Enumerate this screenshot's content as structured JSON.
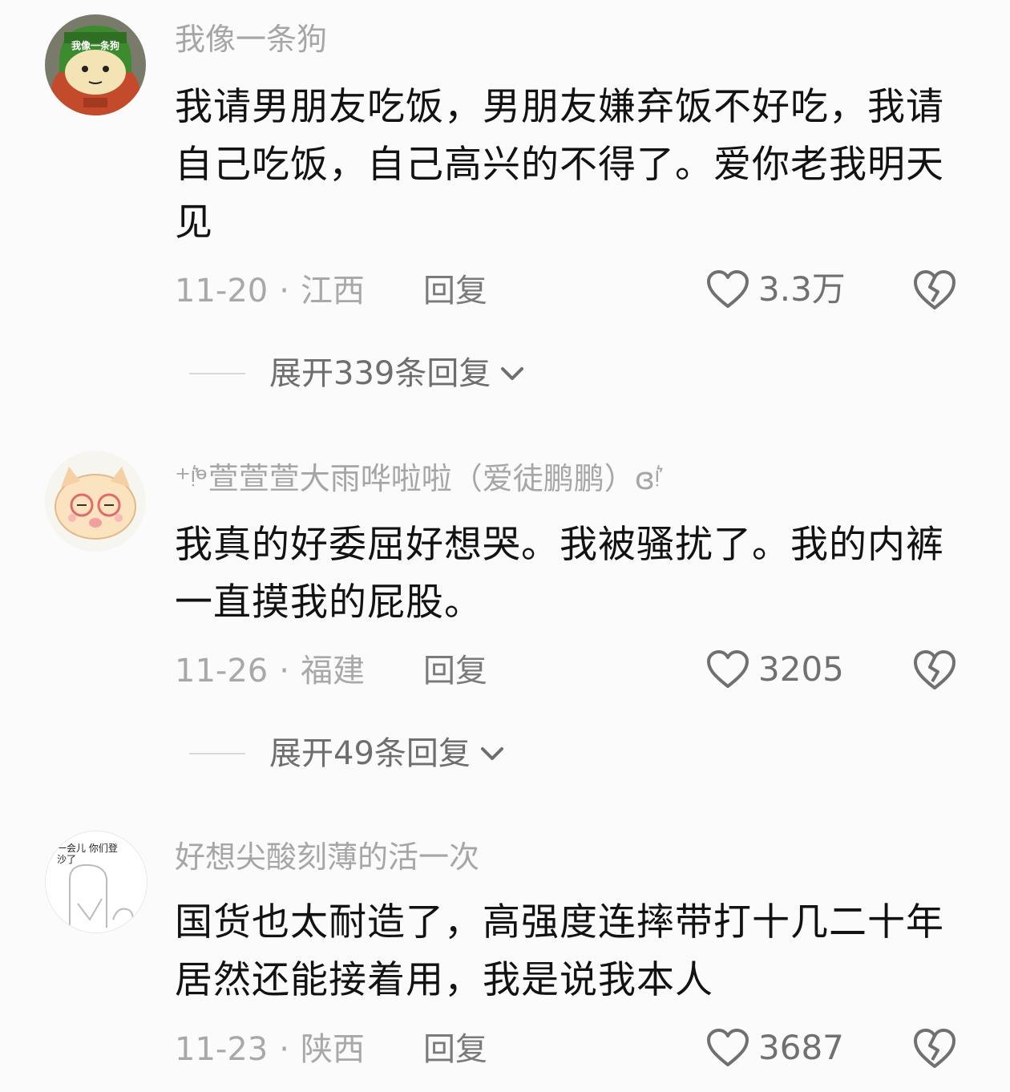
{
  "comments": [
    {
      "username": "我像一条狗",
      "avatar_text": "我像一条狗",
      "text": "我请男朋友吃饭，男朋友嫌弃饭不好吃，我请自己吃饭，自己高兴的不得了。爱你老我明天见",
      "date": "11-20",
      "location": "江西",
      "reply_label": "回复",
      "likes": "3.3万",
      "expand_label": "展开339条回复"
    },
    {
      "username": "⁺ᵎ͛ᶱ萱萱萱大雨哗啦啦（爱徒鹏鹏）ɞᵎ͛",
      "text": "我真的好委屈好想哭。我被骚扰了。我的内裤一直摸我的屁股。",
      "date": "11-26",
      "location": "福建",
      "reply_label": "回复",
      "likes": "3205",
      "expand_label": "展开49条回复"
    },
    {
      "username": "好想尖酸刻薄的活一次",
      "avatar_text": "一会儿 你们登沙了",
      "text": "国货也太耐造了，高强度连摔带打十几二十年居然还能接着用，我是说我本人",
      "date": "11-23",
      "location": "陕西",
      "reply_label": "回复",
      "likes": "3687"
    }
  ],
  "colors": {
    "background": "#fbfbfb",
    "text": "#121212",
    "secondary": "#a6a6a6"
  }
}
